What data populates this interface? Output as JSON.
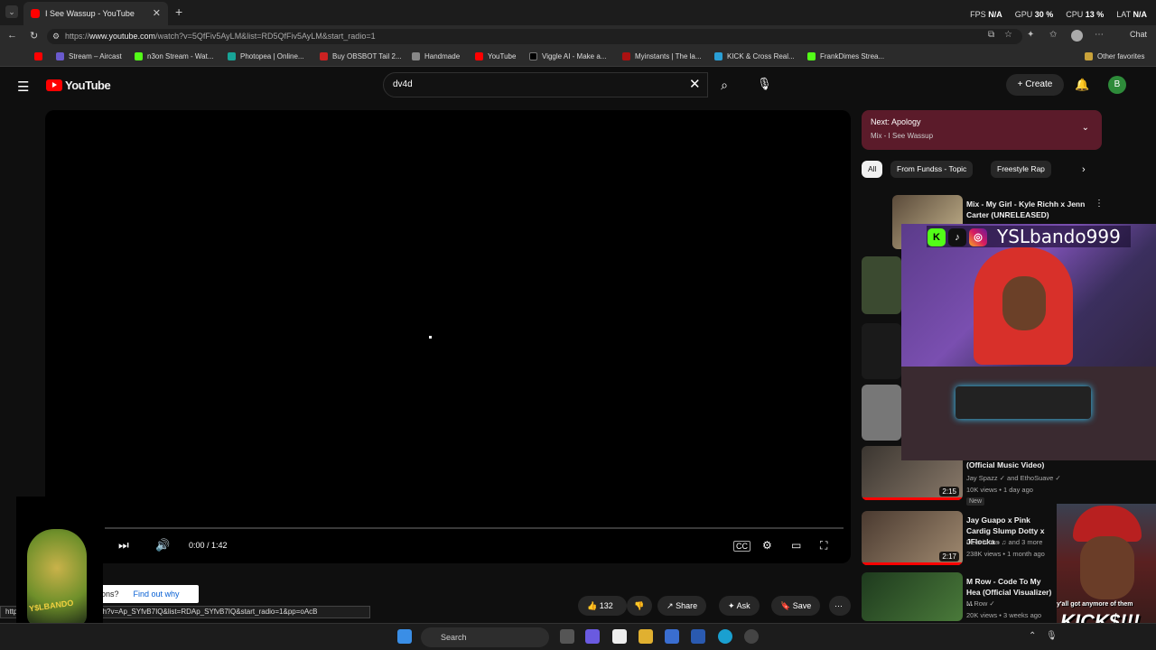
{
  "browser": {
    "tab_title": "I See Wassup - YouTube",
    "new_tab_icon": "+",
    "stats": [
      {
        "label": "FPS",
        "value": "N/A"
      },
      {
        "label": "GPU",
        "value": "30 %"
      },
      {
        "label": "CPU",
        "value": "13 %"
      },
      {
        "label": "LAT",
        "value": "N/A"
      }
    ],
    "url_prefix": "https://",
    "url_domain": "www.youtube.com",
    "url_path": "/watch?v=5QfFiv5AyLM&list=RD5QfFiv5AyLM&start_radio=1",
    "chat_label": "Chat",
    "bookmarks": [
      {
        "label": "Stream – Aircast",
        "color": "#6a5acd"
      },
      {
        "label": "n3on Stream - Wat...",
        "color": "#53fc18"
      },
      {
        "label": "Photopea | Online...",
        "color": "#18a497"
      },
      {
        "label": "Buy OBSBOT Tail 2...",
        "color": "#cc2222"
      },
      {
        "label": "Handmade",
        "color": "#888888"
      },
      {
        "label": "YouTube",
        "color": "#ff0000"
      },
      {
        "label": "Viggle AI - Make a...",
        "color": "#000000"
      },
      {
        "label": "Myinstants | The la...",
        "color": "#aa1111"
      },
      {
        "label": "KICK & Cross Real...",
        "color": "#2a9fd6"
      },
      {
        "label": "FrankDimes Strea...",
        "color": "#53fc18"
      }
    ],
    "other_favorites": "Other favorites"
  },
  "youtube": {
    "logo_text": "YouTube",
    "search_value": "dv4d",
    "create_label": "Create",
    "avatar_letter": "B"
  },
  "player": {
    "time": "0:00 / 1:42",
    "progress": 0
  },
  "below": {
    "find_out_partial": "ons?",
    "find_out_link": "Find out why",
    "status_url": "https://www.youtube.com/watch?v=Ap_SYfvB7IQ&list=RDAp_SYfvB7IQ&start_radio=1&pp=oAcB",
    "like_count": "132",
    "share_label": "Share",
    "ask_label": "Ask",
    "save_label": "Save"
  },
  "sidebar": {
    "next_label": "Next: Apology",
    "next_sub": "Mix - I See Wassup",
    "chips": [
      "All",
      "From Fundss - Topic",
      "Freestyle Rap"
    ],
    "recs": [
      {
        "title": "Mix - My Girl - Kyle Richh x Jenn Carter (UNRELEASED)",
        "channel": "",
        "meta": "",
        "duration": "",
        "is_new": false
      },
      {
        "title": "(Official Music Video)",
        "channel": "Jay Spazz ✓ and EthoSuave ✓",
        "meta": "10K views • 1 day ago",
        "duration": "2:15",
        "is_new": true,
        "new_label": "New"
      },
      {
        "title": "Jay Guapo x Pink Cardig Slump Dotty x JFlocka -",
        "channel": "Deevisions ♫ and 3 more",
        "meta": "238K views • 1 month ago",
        "duration": "2:17",
        "is_new": false
      },
      {
        "title": "M Row - Code To My Hea (Official Visualizer) ...",
        "channel": "M Row ✓",
        "meta": "20K views • 3 weeks ago",
        "duration": "",
        "is_new": false
      }
    ]
  },
  "overlays": {
    "streamer_name": "YSLbando999",
    "kicks_text": "KICK$!!!",
    "kicks_small": "y'all got anymore of them",
    "corner_logo_text": "Y$LBANDO"
  },
  "taskbar": {
    "search_placeholder": "Search"
  }
}
